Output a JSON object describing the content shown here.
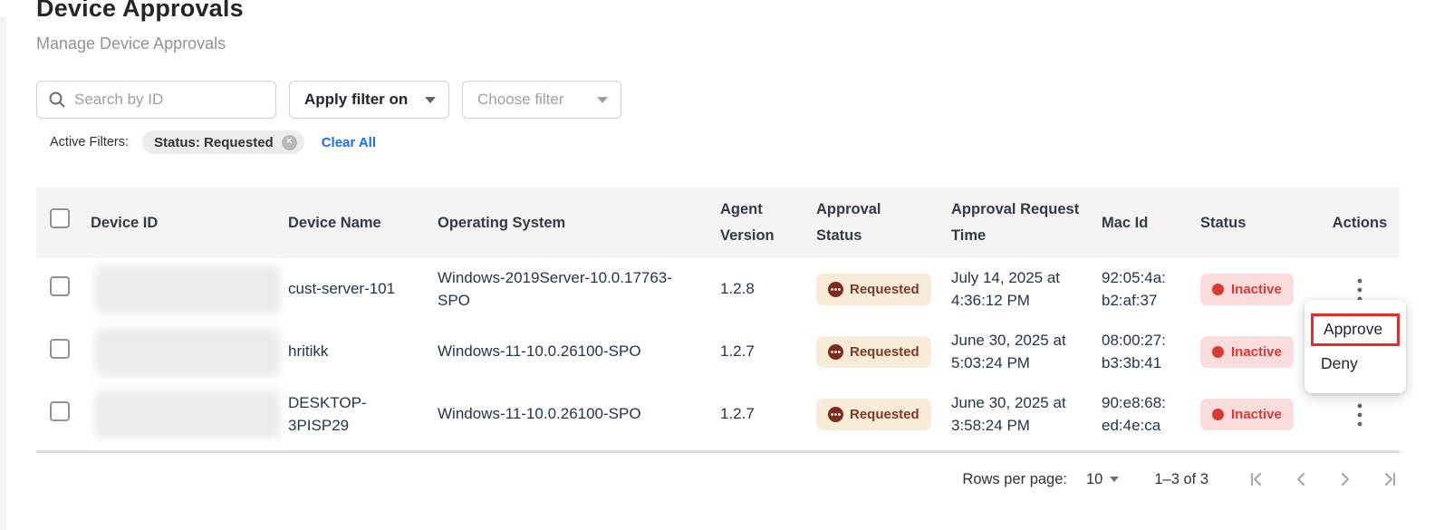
{
  "page": {
    "title": "Device Approvals",
    "subtitle": "Manage Device Approvals"
  },
  "toolbar": {
    "search_placeholder": "Search by ID",
    "apply_filter_label": "Apply filter on",
    "choose_filter_label": "Choose filter"
  },
  "active_filters": {
    "label": "Active Filters:",
    "chips": [
      {
        "label": "Status: Requested"
      }
    ],
    "clear_all_label": "Clear All"
  },
  "table": {
    "columns": [
      "Device ID",
      "Device Name",
      "Operating System",
      "Agent Version",
      "Approval Status",
      "Approval Request Time",
      "Mac Id",
      "Status",
      "Actions"
    ],
    "rows": [
      {
        "device_name": "cust-server-101",
        "os": "Windows-2019Server-10.0.17763-SPO",
        "agent_version": "1.2.8",
        "approval_status": "Requested",
        "request_time": "July 14, 2025 at 4:36:12 PM",
        "mac_id": "92:05:4a:b2:af:37",
        "status": "Inactive"
      },
      {
        "device_name": "hritikk",
        "os": "Windows-11-10.0.26100-SPO",
        "agent_version": "1.2.7",
        "approval_status": "Requested",
        "request_time": "June 30, 2025 at 5:03:24 PM",
        "mac_id": "08:00:27:b3:3b:41",
        "status": "Inactive"
      },
      {
        "device_name": "DESKTOP-3PISP29",
        "os": "Windows-11-10.0.26100-SPO",
        "agent_version": "1.2.7",
        "approval_status": "Requested",
        "request_time": "June 30, 2025 at 3:58:24 PM",
        "mac_id": "90:e8:68:ed:4e:ca",
        "status": "Inactive"
      }
    ]
  },
  "context_menu": {
    "items": [
      {
        "label": "Approve",
        "highlighted": true
      },
      {
        "label": "Deny",
        "highlighted": false
      }
    ]
  },
  "pagination": {
    "rows_per_page_label": "Rows per page:",
    "rows_per_page_value": "10",
    "range_label": "1–3 of 3"
  },
  "colors": {
    "link_blue": "#1a6fe8",
    "requested_badge_bg": "#f8ecd9",
    "requested_badge_fg": "#7d3a2b",
    "requested_icon_bg": "#7b2c1e",
    "inactive_badge_bg": "#fbdcdc",
    "inactive_badge_fg": "#d53b33",
    "approve_highlight_border": "#e52b2b",
    "header_row_bg": "#f4f4f5"
  }
}
